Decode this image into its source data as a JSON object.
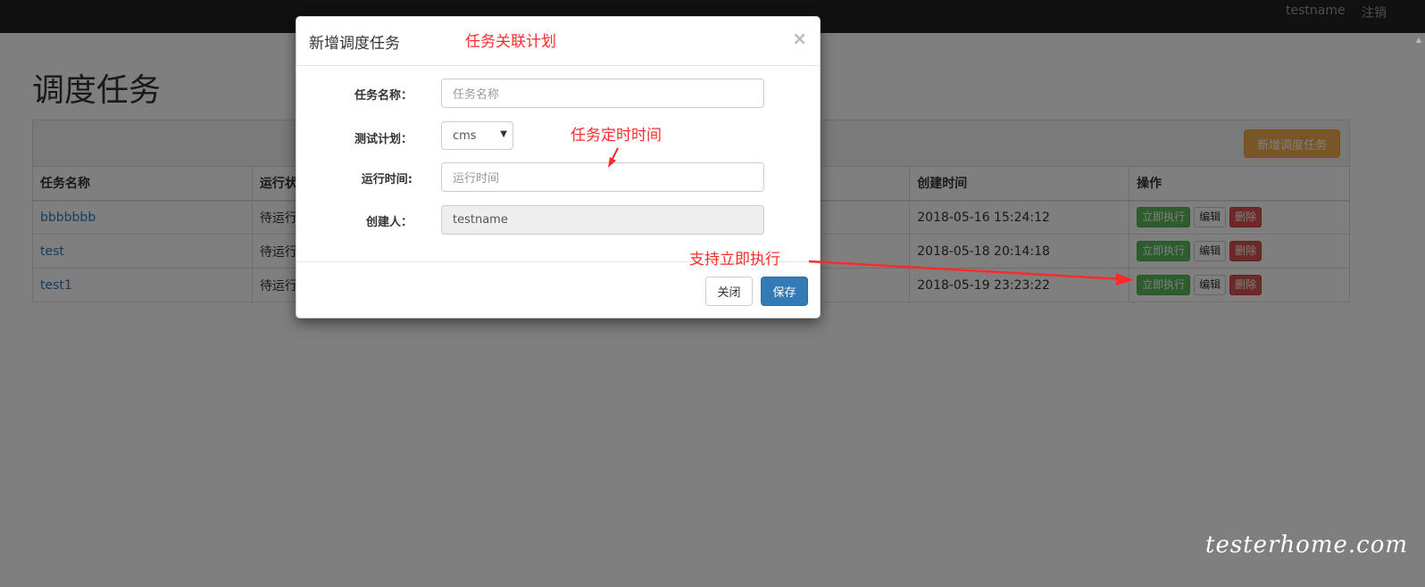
{
  "navbar": {
    "user": "testname",
    "logout": "注销"
  },
  "page": {
    "title": "调度任务",
    "add_button": "新增调度任务"
  },
  "table": {
    "headers": [
      "任务名称",
      "运行状态",
      "创建时间",
      "操作"
    ],
    "rows": [
      {
        "name": "bbbbbbb",
        "status": "待运行",
        "created": "2018-05-16 15:24:12"
      },
      {
        "name": "test",
        "status": "待运行",
        "created": "2018-05-18 20:14:18"
      },
      {
        "name": "test1",
        "status": "待运行",
        "created": "2018-05-19 23:23:22"
      }
    ],
    "actions": {
      "run": "立即执行",
      "edit": "编辑",
      "delete": "删除"
    }
  },
  "modal": {
    "title": "新增调度任务",
    "close_icon": "×",
    "fields": {
      "name_label": "任务名称：",
      "name_placeholder": "任务名称",
      "plan_label": "测试计划：",
      "plan_value": "cms",
      "time_label": "运行时间:",
      "time_placeholder": "运行时间",
      "creator_label": "创建人：",
      "creator_value": "testname"
    },
    "close_button": "关闭",
    "save_button": "保存"
  },
  "annotations": {
    "plan_link": "任务关联计划",
    "schedule_time": "任务定时时间",
    "run_now": "支持立即执行"
  },
  "watermark": "testerhome.com",
  "colors": {
    "navbar": "#222222",
    "primary": "#337ab7",
    "warning": "#f0ad4e",
    "success": "#5cb85c",
    "danger": "#d9534f",
    "annotation": "#ff2a2a"
  }
}
